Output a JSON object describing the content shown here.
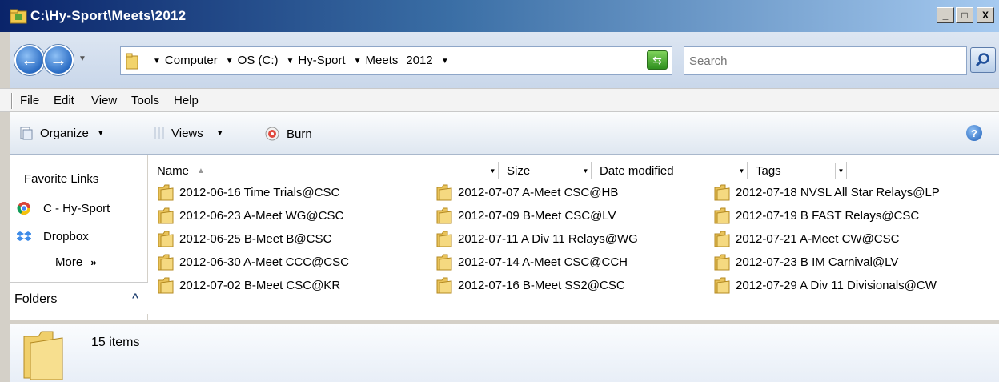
{
  "window": {
    "title": "C:\\Hy-Sport\\Meets\\2012",
    "min_glyph": "_",
    "max_glyph": "□",
    "close_glyph": "X"
  },
  "nav": {
    "crumbs": [
      "Computer",
      "OS (C:)",
      "Hy-Sport",
      "Meets",
      "2012"
    ],
    "search_placeholder": "Search"
  },
  "menu": {
    "items": [
      "File",
      "Edit",
      "View",
      "Tools",
      "Help"
    ]
  },
  "commands": {
    "organize": "Organize",
    "views": "Views",
    "burn": "Burn"
  },
  "sidebar": {
    "title": "Favorite Links",
    "links": [
      "C - Hy-Sport",
      "Dropbox"
    ],
    "more": "More",
    "more_glyph": "»",
    "folders": "Folders"
  },
  "columns": [
    "Name",
    "Size",
    "Date modified",
    "Tags"
  ],
  "files": [
    "2012-06-16 Time Trials@CSC",
    "2012-06-23 A-Meet WG@CSC",
    "2012-06-25 B-Meet B@CSC",
    "2012-06-30 A-Meet CCC@CSC",
    "2012-07-02 B-Meet CSC@KR",
    "2012-07-07 A-Meet CSC@HB",
    "2012-07-09 B-Meet CSC@LV",
    "2012-07-11 A Div 11 Relays@WG",
    "2012-07-14 A-Meet CSC@CCH",
    "2012-07-16 B-Meet SS2@CSC",
    "2012-07-18 NVSL All Star Relays@LP",
    "2012-07-19 B FAST Relays@CSC",
    "2012-07-21 A-Meet CW@CSC",
    "2012-07-23 B IM Carnival@LV",
    "2012-07-29 A Div 11 Divisionals@CW"
  ],
  "status": {
    "count": "15 items"
  },
  "colors": {
    "folder": "#e8c45a",
    "title_gradient_start": "#0a246a"
  }
}
